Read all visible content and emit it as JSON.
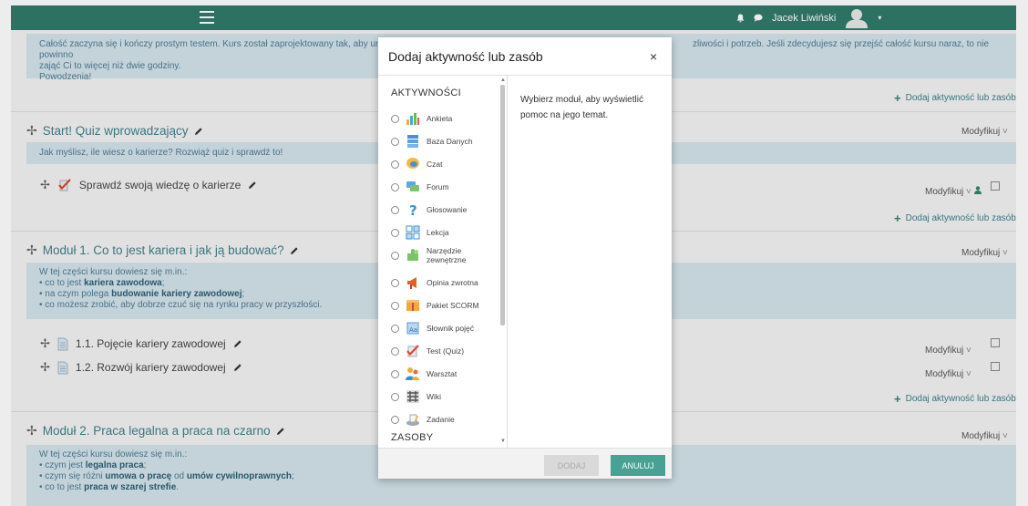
{
  "navbar": {
    "user_name": "Jacek Liwiński"
  },
  "top_summary": {
    "line1": "Całość zaczyna się i kończy prostym testem. Kurs został zaprojektowany tak, aby umo",
    "line1_right": "zliwości i potrzeb. Jeśli zdecydujesz się przejść całość kursu naraz, to nie powinno",
    "line2": "zająć Ci to więcej niż dwie godziny.",
    "line3": "Powodzenia!"
  },
  "labels": {
    "add_activity": "Dodaj aktywność lub zasób",
    "modify": "Modyfikuj"
  },
  "sections": {
    "start": {
      "title": "Start! Quiz wprowadzający",
      "summary": "Jak myślisz, ile wiesz o karierze? Rozwiąż quiz i sprawdź to!",
      "activity": "Sprawdź swoją wiedzę o karierze"
    },
    "mod1": {
      "title": "Moduł 1. Co to jest kariera i jak ją budować?",
      "intro": "W tej części kursu dowiesz się m.in.:",
      "b1_pre": "co to jest ",
      "b1_bold": "kariera zawodowa",
      "b1_post": ";",
      "b2_pre": "na czym polega ",
      "b2_bold": "budowanie kariery zawodowej",
      "b2_post": ";",
      "b3": "co możesz zrobić, aby dobrze czuć się na rynku pracy w przyszłości.",
      "act1": "1.1. Pojęcie kariery zawodowej",
      "act2": "1.2. Rozwój kariery zawodowej"
    },
    "mod2": {
      "title": "Moduł 2. Praca legalna a praca na czarno",
      "intro": "W tej części kursu dowiesz się m.in.:",
      "b1_pre": "czym jest ",
      "b1_bold": "legalna praca",
      "b1_post": ";",
      "b2_pre": "czym się różni ",
      "b2_bold": "umowa o pracę",
      "b2_mid": " od ",
      "b2_bold2": "umów cywilnoprawnych",
      "b2_post": ";",
      "b3_pre": "co to jest ",
      "b3_bold": "praca w szarej strefie",
      "b3_post": "."
    }
  },
  "modal": {
    "title": "Dodaj aktywność lub zasób",
    "close": "×",
    "category_activities": "AKTYWNOŚCI",
    "category_resources": "ZASOBY",
    "help": "Wybierz moduł, aby wyświetlić pomoc na jego temat.",
    "add_button": "DODAJ",
    "cancel_button": "ANULUJ",
    "options": [
      {
        "label": "Ankieta",
        "icon": "chart-bars-icon"
      },
      {
        "label": "Baza Danych",
        "icon": "database-icon"
      },
      {
        "label": "Czat",
        "icon": "chat-bubble-icon"
      },
      {
        "label": "Forum",
        "icon": "forum-icon"
      },
      {
        "label": "Głosowanie",
        "icon": "question-mark-icon"
      },
      {
        "label": "Lekcja",
        "icon": "lesson-icon"
      },
      {
        "label": "Narzędzie zewnętrzne",
        "icon": "puzzle-icon"
      },
      {
        "label": "Opinia zwrotna",
        "icon": "megaphone-icon"
      },
      {
        "label": "Pakiet SCORM",
        "icon": "package-icon"
      },
      {
        "label": "Słownik pojęć",
        "icon": "glossary-icon"
      },
      {
        "label": "Test (Quiz)",
        "icon": "quiz-check-icon"
      },
      {
        "label": "Warsztat",
        "icon": "workshop-people-icon"
      },
      {
        "label": "Wiki",
        "icon": "wiki-icon"
      },
      {
        "label": "Zadanie",
        "icon": "assignment-icon"
      }
    ]
  },
  "colors": {
    "navbar": "#317a6b",
    "accent": "#47a293",
    "summary_bg": "#d3e2ea"
  }
}
